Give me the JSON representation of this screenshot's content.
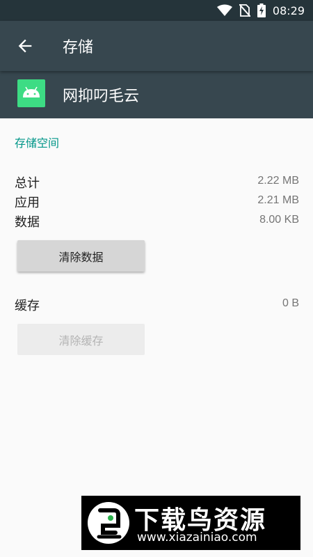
{
  "status": {
    "time": "08:29"
  },
  "appbar": {
    "title": "存储"
  },
  "app": {
    "name": "网抑叼毛云"
  },
  "storage": {
    "section_title": "存储空间",
    "rows": [
      {
        "label": "总计",
        "value": "2.22 MB"
      },
      {
        "label": "应用",
        "value": "2.21 MB"
      },
      {
        "label": "数据",
        "value": "8.00 KB"
      }
    ],
    "clear_data_label": "清除数据",
    "cache_label": "缓存",
    "cache_value": "0 B",
    "clear_cache_label": "清除缓存"
  },
  "watermark": {
    "title": "下载鸟资源",
    "url": "www.xiazainiao.com"
  },
  "colors": {
    "accent": "#009688",
    "appbar": "#37474f",
    "statusbar": "#25343a",
    "android_green": "#3ddc84"
  }
}
